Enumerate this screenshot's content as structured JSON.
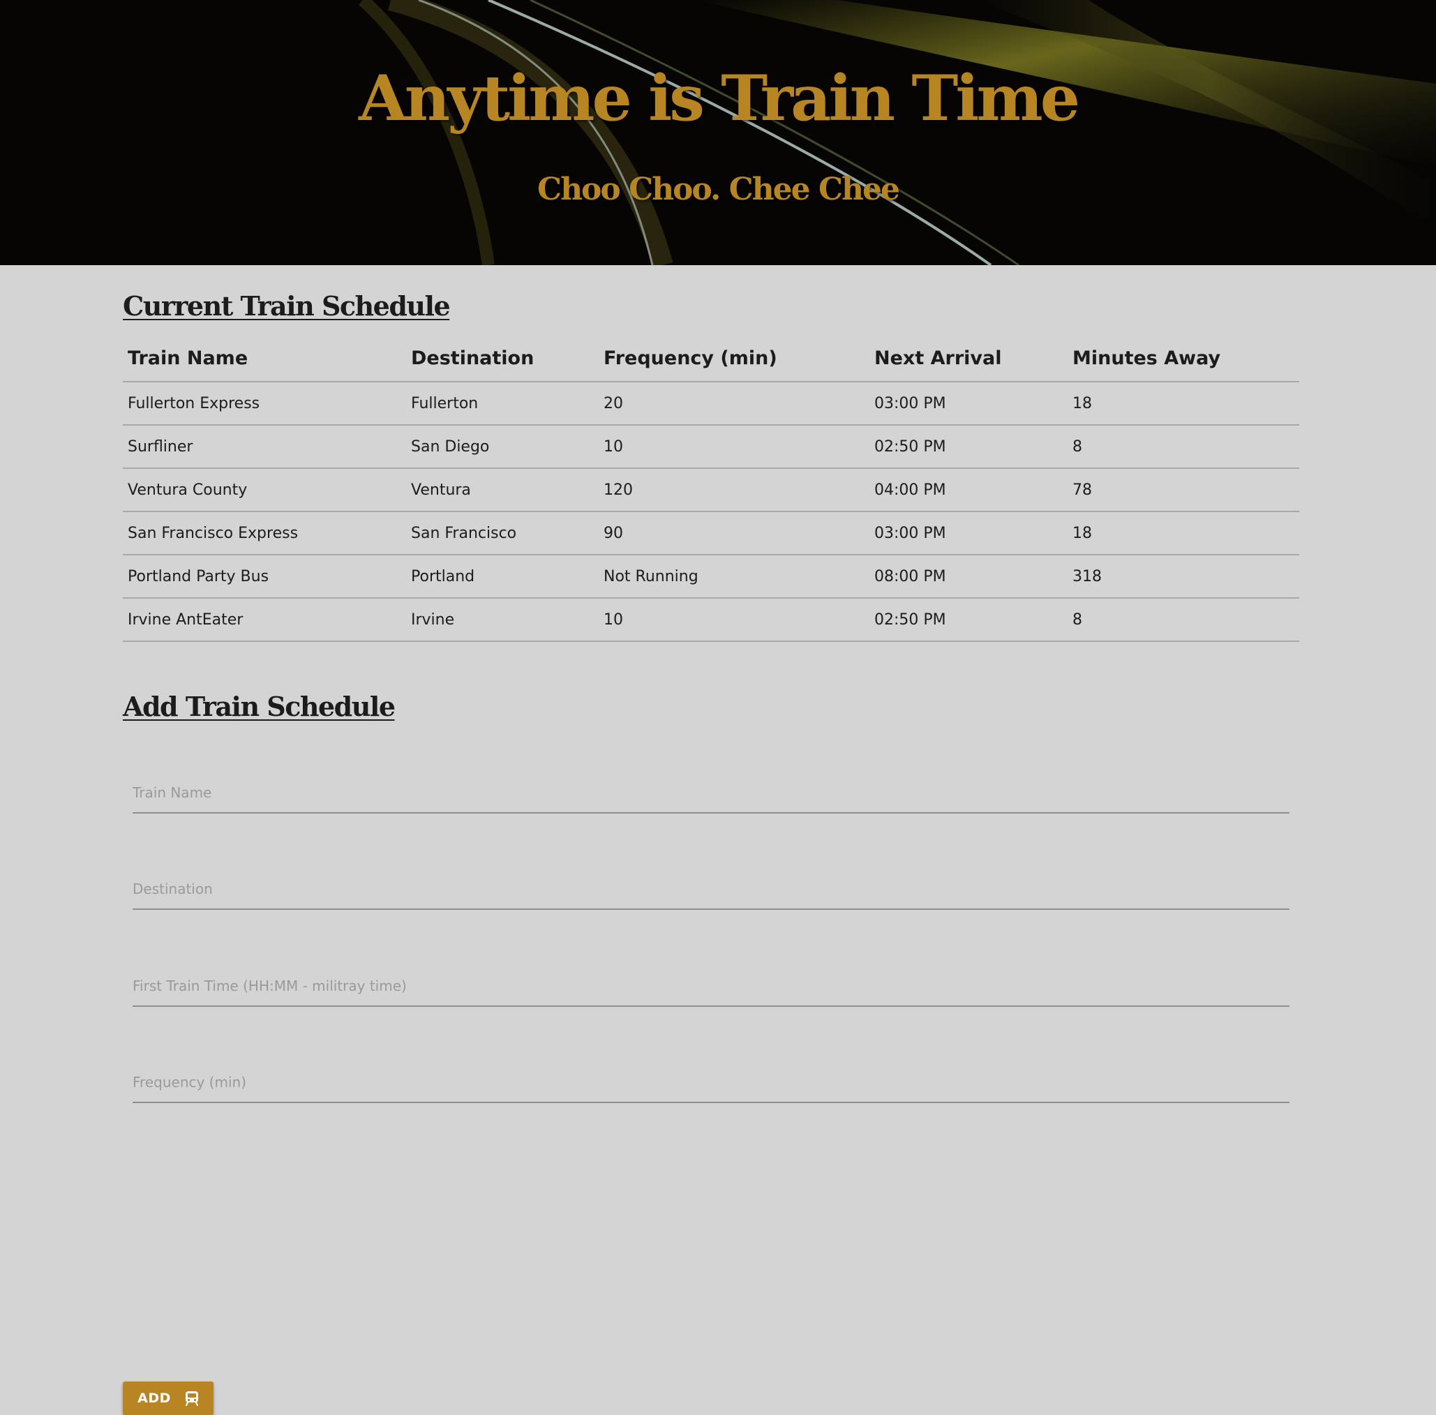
{
  "header": {
    "title": "Anytime is Train Time",
    "subtitle": "Choo Choo. Chee Chee"
  },
  "schedule": {
    "title": "Current Train Schedule",
    "columns": [
      "Train Name",
      "Destination",
      "Frequency (min)",
      "Next Arrival",
      "Minutes Away"
    ],
    "rows": [
      [
        "Fullerton Express",
        "Fullerton",
        "20",
        "03:00 PM",
        "18"
      ],
      [
        "Surfliner",
        "San Diego",
        "10",
        "02:50 PM",
        "8"
      ],
      [
        "Ventura County",
        "Ventura",
        "120",
        "04:00 PM",
        "78"
      ],
      [
        "San Francisco Express",
        "San Francisco",
        "90",
        "03:00 PM",
        "18"
      ],
      [
        "Portland Party Bus",
        "Portland",
        "Not Running",
        "08:00 PM",
        "318"
      ],
      [
        "Irvine AntEater",
        "Irvine",
        "10",
        "02:50 PM",
        "8"
      ]
    ]
  },
  "form": {
    "title": "Add Train Schedule",
    "train_name_placeholder": "Train Name",
    "destination_placeholder": "Destination",
    "first_time_placeholder": "First Train Time (HH:MM - militray time)",
    "frequency_placeholder": "Frequency (min)",
    "add_label": "ADD",
    "add_icon": "train-icon"
  },
  "colors": {
    "accent": "#b98523",
    "page_background": "#d4d4d4",
    "header_background": "#050403"
  }
}
